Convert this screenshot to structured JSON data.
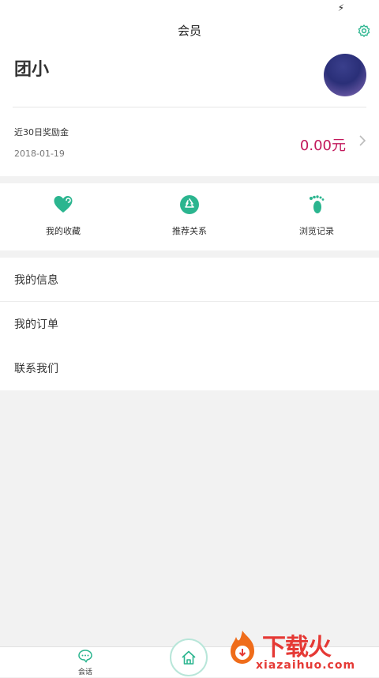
{
  "status_bar": {
    "charge_icon": "lightning-bolt-icon"
  },
  "header": {
    "title": "会员",
    "settings_icon": "gear-icon"
  },
  "profile": {
    "username": "团小",
    "avatar_icon": "avatar"
  },
  "reward": {
    "label": "近30日奖励金",
    "date": "2018-01-19",
    "amount": "0.00元"
  },
  "quick_actions": [
    {
      "label": "我的收藏",
      "icon": "heart-icon"
    },
    {
      "label": "推荐关系",
      "icon": "recycle-icon"
    },
    {
      "label": "浏览记录",
      "icon": "footprint-icon"
    }
  ],
  "menu": {
    "items": [
      {
        "label": "我的信息"
      },
      {
        "label": "我的订单"
      },
      {
        "label": "联系我们"
      }
    ]
  },
  "tabbar": {
    "chat_label": "会话",
    "chat_icon": "chat-bubble-icon",
    "home_icon": "home-icon"
  },
  "watermark": {
    "text": "下载火",
    "url": "xiazaihuo.com"
  },
  "colors": {
    "accent": "#2bb58f",
    "amount": "#c2185b",
    "watermark": "#e53935"
  }
}
